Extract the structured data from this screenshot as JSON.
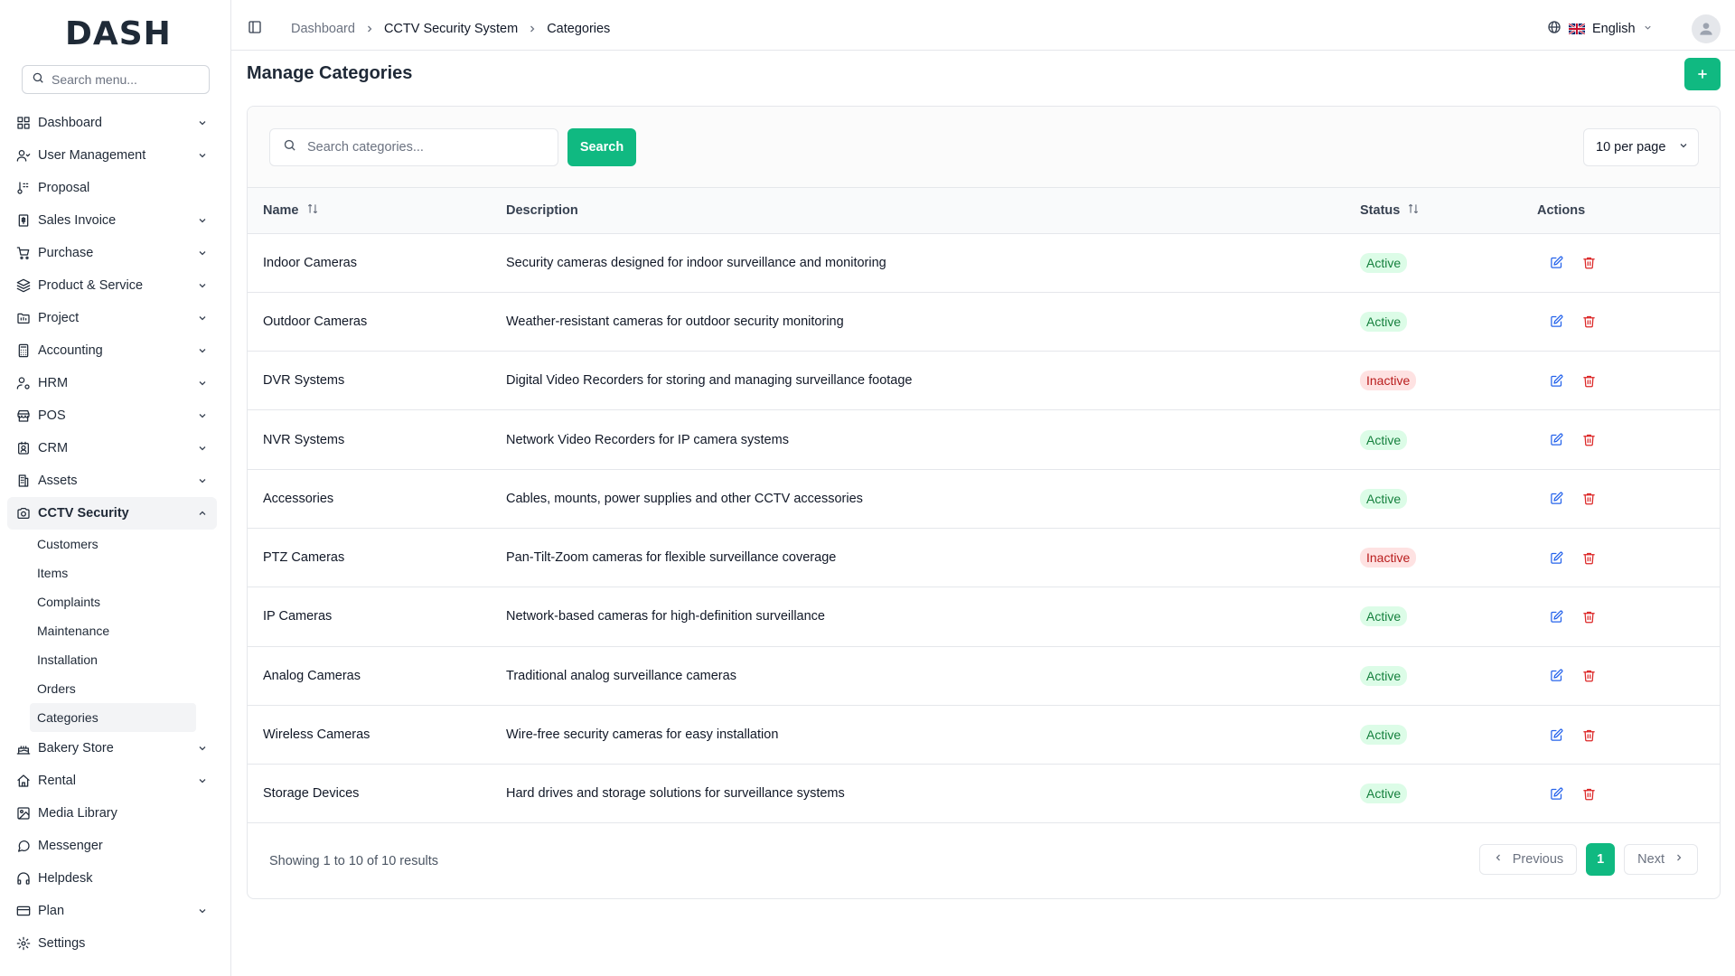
{
  "app": {
    "logo_text": "DASH",
    "brand_color": "#10b981"
  },
  "sidebar": {
    "search_placeholder": "Search menu...",
    "items": [
      {
        "label": "Dashboard",
        "icon": "grid-icon",
        "has_children": true
      },
      {
        "label": "User Management",
        "icon": "users-icon",
        "has_children": true
      },
      {
        "label": "Proposal",
        "icon": "proposal-icon",
        "has_children": false
      },
      {
        "label": "Sales Invoice",
        "icon": "invoice-icon",
        "has_children": true
      },
      {
        "label": "Purchase",
        "icon": "cart-icon",
        "has_children": true
      },
      {
        "label": "Product & Service",
        "icon": "layers-icon",
        "has_children": true
      },
      {
        "label": "Project",
        "icon": "folder-icon",
        "has_children": true
      },
      {
        "label": "Accounting",
        "icon": "calculator-icon",
        "has_children": true
      },
      {
        "label": "HRM",
        "icon": "user-cog-icon",
        "has_children": true
      },
      {
        "label": "POS",
        "icon": "store-icon",
        "has_children": true
      },
      {
        "label": "CRM",
        "icon": "contact-icon",
        "has_children": true
      },
      {
        "label": "Assets",
        "icon": "building-icon",
        "has_children": true
      },
      {
        "label": "CCTV Security",
        "icon": "camera-icon",
        "has_children": true,
        "open": true
      },
      {
        "label": "Bakery Store",
        "icon": "cake-icon",
        "has_children": true
      },
      {
        "label": "Rental",
        "icon": "home-icon",
        "has_children": true
      },
      {
        "label": "Media Library",
        "icon": "image-icon",
        "has_children": false
      },
      {
        "label": "Messenger",
        "icon": "message-icon",
        "has_children": false
      },
      {
        "label": "Helpdesk",
        "icon": "headphones-icon",
        "has_children": false
      },
      {
        "label": "Plan",
        "icon": "card-icon",
        "has_children": true
      },
      {
        "label": "Settings",
        "icon": "gear-icon",
        "has_children": false
      }
    ],
    "cctv_sub_items": [
      {
        "label": "Customers"
      },
      {
        "label": "Items"
      },
      {
        "label": "Complaints"
      },
      {
        "label": "Maintenance"
      },
      {
        "label": "Installation"
      },
      {
        "label": "Orders"
      },
      {
        "label": "Categories",
        "active": true
      }
    ]
  },
  "header": {
    "breadcrumb": [
      "Dashboard",
      "CCTV Security System",
      "Categories"
    ],
    "language": "English"
  },
  "main": {
    "title": "Manage Categories",
    "add_button_label": "+",
    "search_placeholder": "Search categories...",
    "search_button": "Search",
    "per_page": "10 per page",
    "columns": {
      "name": "Name",
      "description": "Description",
      "status": "Status",
      "actions": "Actions"
    },
    "rows": [
      {
        "name": "Indoor Cameras",
        "description": "Security cameras designed for indoor surveillance and monitoring",
        "status": "Active"
      },
      {
        "name": "Outdoor Cameras",
        "description": "Weather-resistant cameras for outdoor security monitoring",
        "status": "Active"
      },
      {
        "name": "DVR Systems",
        "description": "Digital Video Recorders for storing and managing surveillance footage",
        "status": "Inactive"
      },
      {
        "name": "NVR Systems",
        "description": "Network Video Recorders for IP camera systems",
        "status": "Active"
      },
      {
        "name": "Accessories",
        "description": "Cables, mounts, power supplies and other CCTV accessories",
        "status": "Active"
      },
      {
        "name": "PTZ Cameras",
        "description": "Pan-Tilt-Zoom cameras for flexible surveillance coverage",
        "status": "Inactive"
      },
      {
        "name": "IP Cameras",
        "description": "Network-based cameras for high-definition surveillance",
        "status": "Active"
      },
      {
        "name": "Analog Cameras",
        "description": "Traditional analog surveillance cameras",
        "status": "Active"
      },
      {
        "name": "Wireless Cameras",
        "description": "Wire-free security cameras for easy installation",
        "status": "Active"
      },
      {
        "name": "Storage Devices",
        "description": "Hard drives and storage solutions for surveillance systems",
        "status": "Active"
      }
    ],
    "pagination": {
      "summary": "Showing 1 to 10 of 10 results",
      "previous": "Previous",
      "current_page": "1",
      "next": "Next"
    }
  }
}
